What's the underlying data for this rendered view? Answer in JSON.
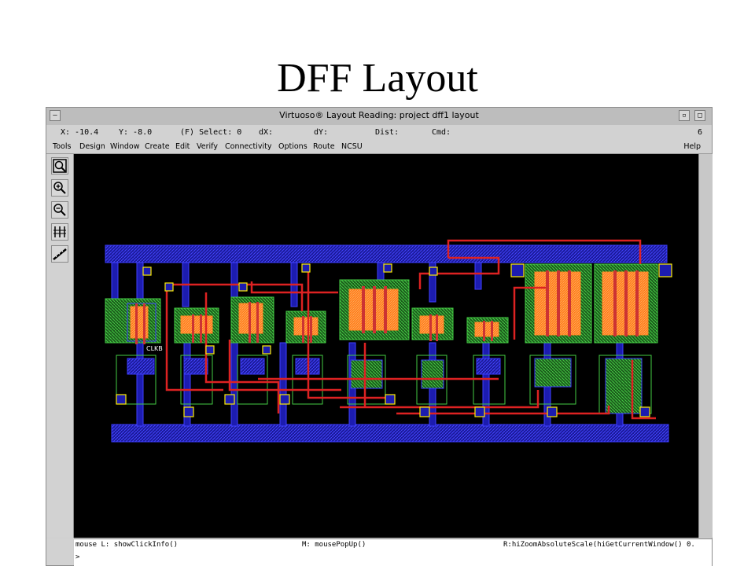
{
  "slide": {
    "title": "DFF Layout"
  },
  "window": {
    "title": "Virtuoso® Layout Reading: project dff1 layout",
    "minimize_label": "—",
    "close_label": "□",
    "window_number": "6"
  },
  "status": {
    "x": "X: -10.4",
    "y": "Y: -8.0",
    "select": "(F) Select: 0",
    "dx": "dX:",
    "dy": "dY:",
    "dist": "Dist:",
    "cmd": "Cmd:"
  },
  "menu": {
    "items": [
      "Tools",
      "Design",
      "Window",
      "Create",
      "Edit",
      "Verify",
      "Connectivity",
      "Options",
      "Route",
      "NCSU"
    ],
    "help": "Help"
  },
  "toolbar": {
    "icons": [
      "zoom-fit-icon",
      "zoom-in-icon",
      "zoom-out-icon",
      "stretch-icon",
      "ruler-icon"
    ]
  },
  "canvas": {
    "label": "CLKB",
    "colors": {
      "background": "#000000",
      "metal1": "#2222ee",
      "metal2": "#dd2222",
      "nwell": "#33bb33",
      "active": "#ff8822",
      "poly": "#cc3333",
      "contact": "#ffee00",
      "metal1_fill": "#3333cc"
    }
  },
  "command_area": {
    "mouse_left": "mouse L: showClickInfo()",
    "mouse_middle": "M: mousePopUp()",
    "mouse_right": "R:hiZoomAbsoluteScale(hiGetCurrentWindow() 0.",
    "prompt": ">"
  }
}
